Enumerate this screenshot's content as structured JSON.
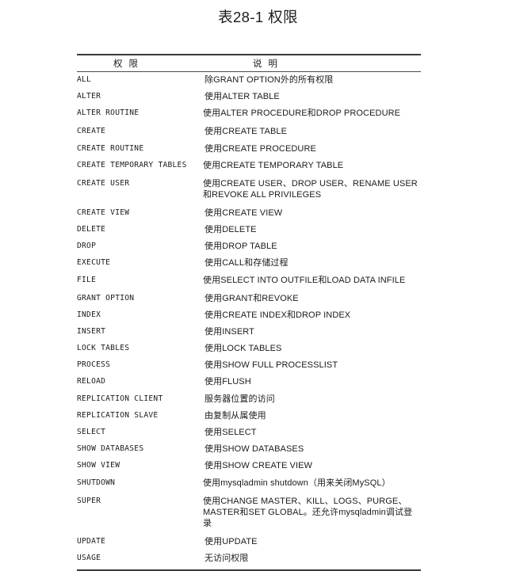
{
  "document": {
    "caption": "表28-1 权限",
    "language": "zh-CN"
  },
  "table": {
    "headers": {
      "privilege": {
        "char1": "权",
        "char2": "限"
      },
      "description": {
        "char1": "说",
        "char2": "明"
      }
    },
    "rows": [
      {
        "privilege": "ALL",
        "description": "除GRANT OPTION外的所有权限"
      },
      {
        "privilege": "ALTER",
        "description": "使用ALTER TABLE"
      },
      {
        "privilege": "ALTER ROUTINE",
        "description": "使用ALTER PROCEDURE和DROP PROCEDURE"
      },
      {
        "privilege": "CREATE",
        "description": "使用CREATE TABLE"
      },
      {
        "privilege": "CREATE ROUTINE",
        "description": "使用CREATE PROCEDURE"
      },
      {
        "privilege": "CREATE TEMPORARY TABLES",
        "description": "使用CREATE TEMPORARY TABLE"
      },
      {
        "privilege": "CREATE USER",
        "description": "使用CREATE USER、DROP USER、RENAME USER和REVOKE ALL PRIVILEGES"
      },
      {
        "privilege": "CREATE VIEW",
        "description": "使用CREATE VIEW"
      },
      {
        "privilege": "DELETE",
        "description": "使用DELETE"
      },
      {
        "privilege": "DROP",
        "description": "使用DROP TABLE"
      },
      {
        "privilege": "EXECUTE",
        "description": "使用CALL和存储过程"
      },
      {
        "privilege": "FILE",
        "description": "使用SELECT INTO OUTFILE和LOAD DATA INFILE"
      },
      {
        "privilege": "GRANT OPTION",
        "description": "使用GRANT和REVOKE"
      },
      {
        "privilege": "INDEX",
        "description": "使用CREATE INDEX和DROP INDEX"
      },
      {
        "privilege": "INSERT",
        "description": "使用INSERT"
      },
      {
        "privilege": "LOCK TABLES",
        "description": "使用LOCK TABLES"
      },
      {
        "privilege": "PROCESS",
        "description": "使用SHOW FULL PROCESSLIST"
      },
      {
        "privilege": "RELOAD",
        "description": "使用FLUSH"
      },
      {
        "privilege": "REPLICATION CLIENT",
        "description": "服务器位置的访问"
      },
      {
        "privilege": "REPLICATION SLAVE",
        "description": "由复制从属使用"
      },
      {
        "privilege": "SELECT",
        "description": "使用SELECT"
      },
      {
        "privilege": "SHOW DATABASES",
        "description": "使用SHOW DATABASES"
      },
      {
        "privilege": "SHOW VIEW",
        "description": "使用SHOW CREATE VIEW"
      },
      {
        "privilege": "SHUTDOWN",
        "description": "使用mysqladmin shutdown（用来关闭MySQL）"
      },
      {
        "privilege": "SUPER",
        "description": "使用CHANGE MASTER、KILL、LOGS、PURGE、MASTER和SET GLOBAL。还允许mysqladmin调试登录"
      },
      {
        "privilege": "UPDATE",
        "description": "使用UPDATE"
      },
      {
        "privilege": "USAGE",
        "description": "无访问权限"
      }
    ]
  },
  "colors": {
    "page_background": "#ffffff",
    "text": "#1b1b1b",
    "rule_heavy": "#3a3a3a",
    "rule_light": "#4a4a4a"
  }
}
